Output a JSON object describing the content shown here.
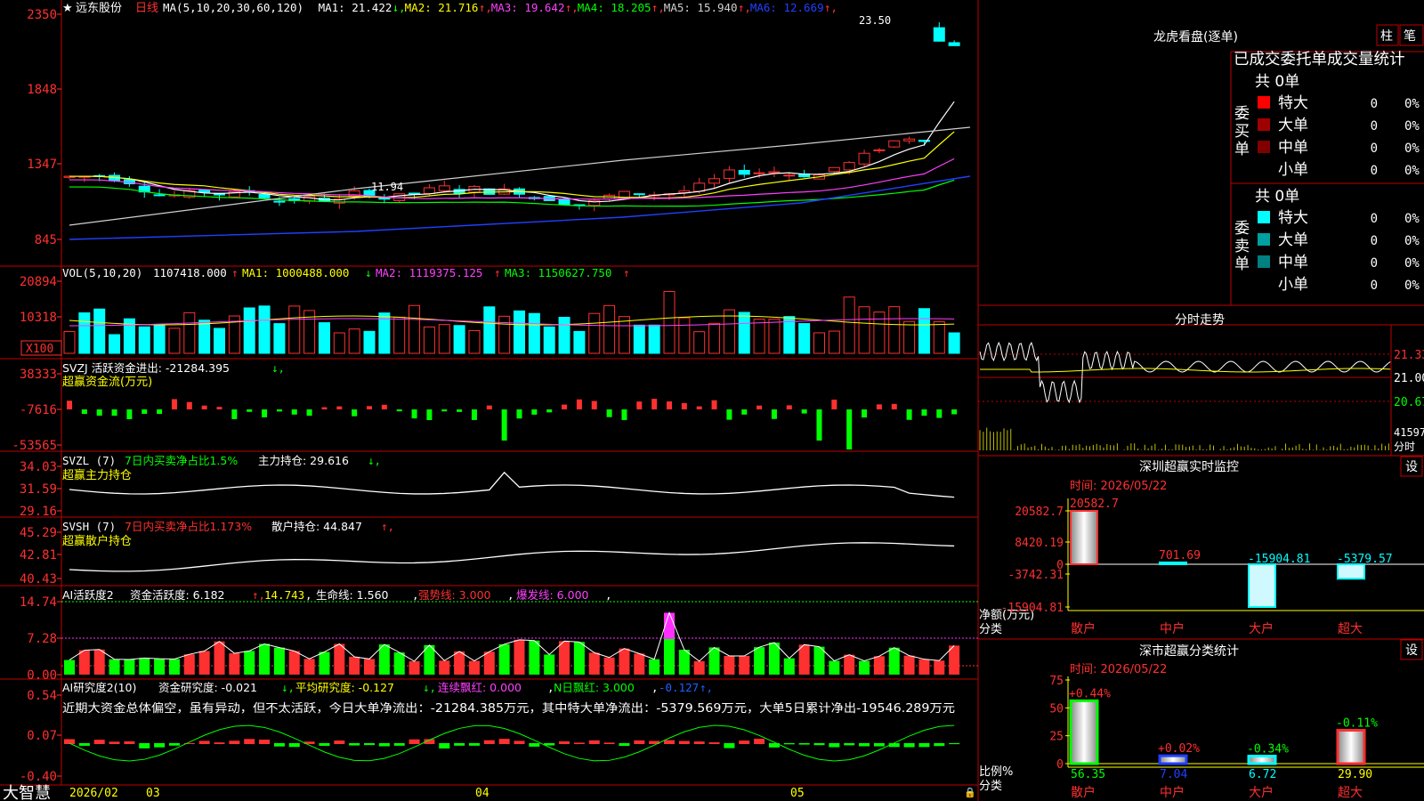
{
  "app": {
    "brand": "大智慧"
  },
  "timeline": {
    "start": "2026/02",
    "months": [
      "03",
      "04",
      "05"
    ]
  },
  "colors": {
    "up": "#ff3030",
    "down": "#00ffff",
    "green": "#00ff00",
    "magenta": "#ff30ff",
    "yellow": "#ffff00",
    "frame": "#c00000"
  },
  "kline": {
    "star": "★",
    "stock_name": "远东股份",
    "period": "日线",
    "ma_params": "MA(5,10,20,30,60,120)",
    "ma": [
      {
        "label": "MA1: 21.422",
        "arrow": "↓",
        "color": "#ffffff"
      },
      {
        "label": "MA2: 21.716",
        "arrow": "↑",
        "color": "#ffff00"
      },
      {
        "label": "MA3: 19.642",
        "arrow": "↑",
        "color": "#ff40ff"
      },
      {
        "label": "MA4: 18.205",
        "arrow": "↑",
        "color": "#00ff00"
      },
      {
        "label": "MA5: 15.940",
        "arrow": "↑",
        "color": "#d0d0d0"
      },
      {
        "label": "MA6: 12.669",
        "arrow": "↑",
        "color": "#2040ff"
      }
    ],
    "yticks": [
      "2350",
      "1848",
      "1347",
      "845"
    ],
    "high_label": "23.50",
    "low_label": "11.94"
  },
  "vol": {
    "header": "VOL(5,10,20)",
    "value": "1107418.000",
    "ma1": "MA1: 1000488.000",
    "ma2": "MA2: 1119375.125",
    "ma3": "MA3: 1150627.750",
    "yticks": [
      "20894",
      "10318"
    ],
    "unit": "X100"
  },
  "svzj": {
    "line1": "SVZJ  活跃资金进出: -21284.395",
    "line2": "超赢资金流(万元)",
    "yticks": [
      "38333",
      "-7616",
      "-53565"
    ]
  },
  "svzl": {
    "name": "SVZL (7)",
    "desc": "7日内买卖净占比1.5%",
    "hold": "主力持仓: 29.616",
    "line2": "超赢主力持仓",
    "yticks": [
      "34.03",
      "31.59",
      "29.16"
    ]
  },
  "svsh": {
    "name": "SVSH (7)",
    "desc": "7日内买卖净占比1.173%",
    "hold": "散户持仓: 44.847",
    "line2": "超赢散户持仓",
    "yticks": [
      "45.29",
      "42.81",
      "40.43"
    ]
  },
  "ai_active": {
    "name": "AI活跃度2",
    "a": "资金活跃度: 6.182",
    "b": "14.743",
    "c": "生命线: 1.560",
    "d": "强势线: 3.000",
    "e": "爆发线: 6.000",
    "yticks": [
      "14.74",
      "7.28",
      "0.00"
    ]
  },
  "ai_research": {
    "name": "AI研究度2(10)",
    "a": "资金研究度: -0.021",
    "b": "平均研究度: -0.127",
    "c": "连续飘红: 0.000",
    "d": "N日飘红: 3.000",
    "e": "-0.127",
    "comment": "近期大资金总体偏空，虽有异动，但不太活跃，今日大单净流出：-21284.385万元，其中特大单净流出：-5379.569万元，大单5日累计净出-19546.289万元",
    "yticks": [
      "0.54",
      "0.07",
      "-0.40"
    ]
  },
  "right": {
    "longhu": {
      "title": "龙虎看盘(逐单)",
      "btn_zhu": "柱",
      "btn_bi": "笔",
      "stat_title": "已成交委托单成交量统计",
      "buy": {
        "side": "委买单",
        "total": "共 0单",
        "rows": [
          {
            "name": "特大",
            "count": "0",
            "pct": "0%",
            "color": "#ff0000"
          },
          {
            "name": "大单",
            "count": "0",
            "pct": "0%",
            "color": "#a00000"
          },
          {
            "name": "中单",
            "count": "0",
            "pct": "0%",
            "color": "#800000"
          },
          {
            "name": "小单",
            "count": "0",
            "pct": "0%",
            "color": "#000000"
          }
        ]
      },
      "sell": {
        "side": "委卖单",
        "total": "共 0单",
        "rows": [
          {
            "name": "特大",
            "count": "0",
            "pct": "0%",
            "color": "#00ffff"
          },
          {
            "name": "大单",
            "count": "0",
            "pct": "0%",
            "color": "#00a0a0"
          },
          {
            "name": "中单",
            "count": "0",
            "pct": "0%",
            "color": "#008080"
          },
          {
            "name": "小单",
            "count": "0",
            "pct": "0%",
            "color": "#000000"
          }
        ]
      }
    },
    "fenshi": {
      "title": "分时走势",
      "yticks": [
        "21.33",
        "21.00",
        "20.67"
      ],
      "vol_label": "41597",
      "vol_unit": "分时"
    },
    "monitor": {
      "title": "深圳超赢实时监控",
      "btn": "设",
      "time": "时间: 2026/05/22",
      "yticks": [
        "20582.7",
        "8420.19",
        "0",
        "-3742.31",
        "-15904.81"
      ],
      "ylabel1": "净额(万元)",
      "ylabel2": "分类",
      "categories": [
        "散户",
        "中户",
        "大户",
        "超大"
      ],
      "values": [
        20582.7,
        701.69,
        -15904.81,
        -5379.57
      ],
      "labels": [
        "20582.7",
        "701.69",
        "-15904.81",
        "-5379.57"
      ]
    },
    "classify": {
      "title": "深市超赢分类统计",
      "btn": "设",
      "time": "时间: 2026/05/22",
      "yticks": [
        "75",
        "50",
        "25",
        "0"
      ],
      "ylabel1": "比例%",
      "ylabel2": "分类",
      "categories": [
        "散户",
        "中户",
        "大户",
        "超大"
      ],
      "values": [
        56.35,
        7.04,
        6.72,
        29.9
      ],
      "labels": [
        "56.35",
        "7.04",
        "6.72",
        "29.90"
      ],
      "changes": [
        "+0.44%",
        "+0.02%",
        "-0.34%",
        "-0.11%"
      ]
    }
  },
  "chart_data": [
    {
      "type": "bar",
      "title": "深圳超赢实时监控",
      "ylabel": "净额(万元)",
      "xlabel": "分类",
      "categories": [
        "散户",
        "中户",
        "大户",
        "超大"
      ],
      "values": [
        20582.7,
        701.69,
        -15904.81,
        -5379.57
      ],
      "ylim": [
        -15904.81,
        20582.7
      ]
    },
    {
      "type": "bar",
      "title": "深市超赢分类统计",
      "ylabel": "比例%",
      "xlabel": "分类",
      "categories": [
        "散户",
        "中户",
        "大户",
        "超大"
      ],
      "values": [
        56.35,
        7.04,
        6.72,
        29.9
      ],
      "ylim": [
        0,
        75
      ]
    }
  ]
}
